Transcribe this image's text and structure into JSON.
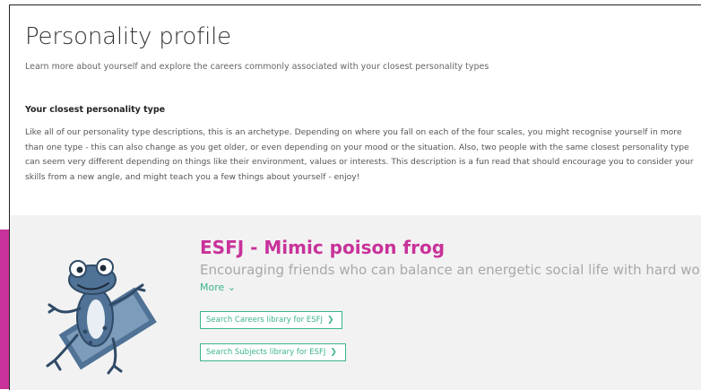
{
  "header": {
    "title": "Personality profile",
    "subtitle": "Learn more about yourself and explore the careers commonly associated with your closest personality types"
  },
  "closest_type_section": {
    "heading": "Your closest personality type",
    "body": "Like all of our personality type descriptions, this is an archetype. Depending on where you fall on each of the four scales, you might recognise yourself in more than one type - this can also change as you get older, or even depending on your mood or the situation. Also, two people with the same closest personality type can seem very different depending on things like their environment, values or interests. This description is a fun read that should encourage you to consider your skills from a new angle, and might teach you a few things about yourself - enjoy!"
  },
  "result": {
    "title": "ESFJ - Mimic poison frog",
    "tagline": "Encouraging friends who can balance an energetic social life with hard work.",
    "more_label": "More",
    "more_icon": "chevron-down-icon",
    "careers_button": "Search Careers library for ESFJ",
    "subjects_button": "Search Subjects library for ESFJ",
    "button_icon": "chevron-right-icon",
    "mascot_icon": "frog-illustration"
  },
  "colors": {
    "accent_magenta": "#c8329a",
    "accent_green": "#3bb58a",
    "frog_blue": "#4f7296",
    "panel_bg": "#f2f2f2"
  }
}
